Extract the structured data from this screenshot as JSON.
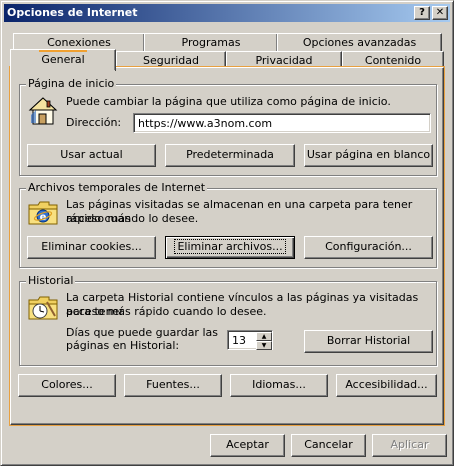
{
  "window": {
    "title": "Opciones de Internet",
    "help_label": "?",
    "close_label": "✕"
  },
  "tabs_back": [
    "Conexiones",
    "Programas",
    "Opciones avanzadas"
  ],
  "tabs_front": [
    "General",
    "Seguridad",
    "Privacidad",
    "Contenido"
  ],
  "active_tab": "General",
  "home": {
    "legend": "Página de inicio",
    "description": "Puede cambiar la página que utiliza como página de inicio.",
    "address_label": "Dirección:",
    "address_value": "https://www.a3nom.com",
    "buttons": [
      "Usar actual",
      "Predeterminada",
      "Usar página en blanco"
    ]
  },
  "temp": {
    "legend": "Archivos temporales de Internet",
    "description_line1": "Las páginas visitadas se almacenan en una carpeta para tener acceso más",
    "description_line2": "rápido cuando lo desee.",
    "buttons": [
      "Eliminar cookies...",
      "Eliminar archivos...",
      "Configuración..."
    ]
  },
  "history": {
    "legend": "Historial",
    "description_line1": "La carpeta Historial contiene vínculos a las páginas ya visitadas para tener",
    "description_line2": "acceso más rápido cuando lo desee.",
    "days_label_line1": "Días que puede guardar las",
    "days_label_line2": "páginas en Historial:",
    "days_value": "13",
    "clear_button": "Borrar Historial"
  },
  "bottom_buttons": [
    "Colores...",
    "Fuentes...",
    "Idiomas...",
    "Accesibilidad..."
  ],
  "dialog_buttons": {
    "ok": "Aceptar",
    "cancel": "Cancelar",
    "apply": "Aplicar"
  }
}
